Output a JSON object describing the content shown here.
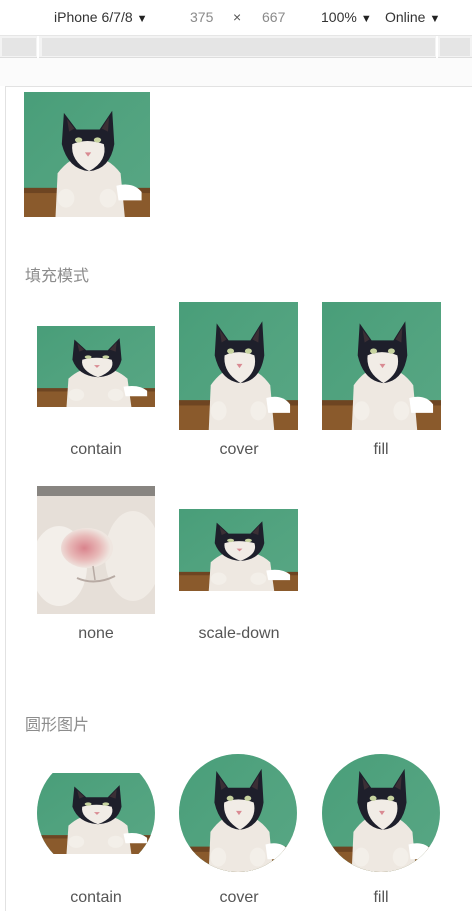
{
  "devtools": {
    "device": "iPhone 6/7/8",
    "width": "375",
    "times": "×",
    "height": "667",
    "zoom": "100%",
    "throttle": "Online",
    "caret": "▼"
  },
  "sections": {
    "fill_mode_title": "填充模式",
    "round_title": "圆形图片"
  },
  "modes": {
    "contain": "contain",
    "cover": "cover",
    "fill": "fill",
    "none": "none",
    "scale_down": "scale-down"
  },
  "colors": {
    "bg_green": "#4fa07d",
    "table_wood": "#8a5a2c",
    "fur_white": "#f1ece6",
    "fur_dark": "#1e1f2b",
    "nose_pink": "#d98a92"
  },
  "image_subject": "cat"
}
